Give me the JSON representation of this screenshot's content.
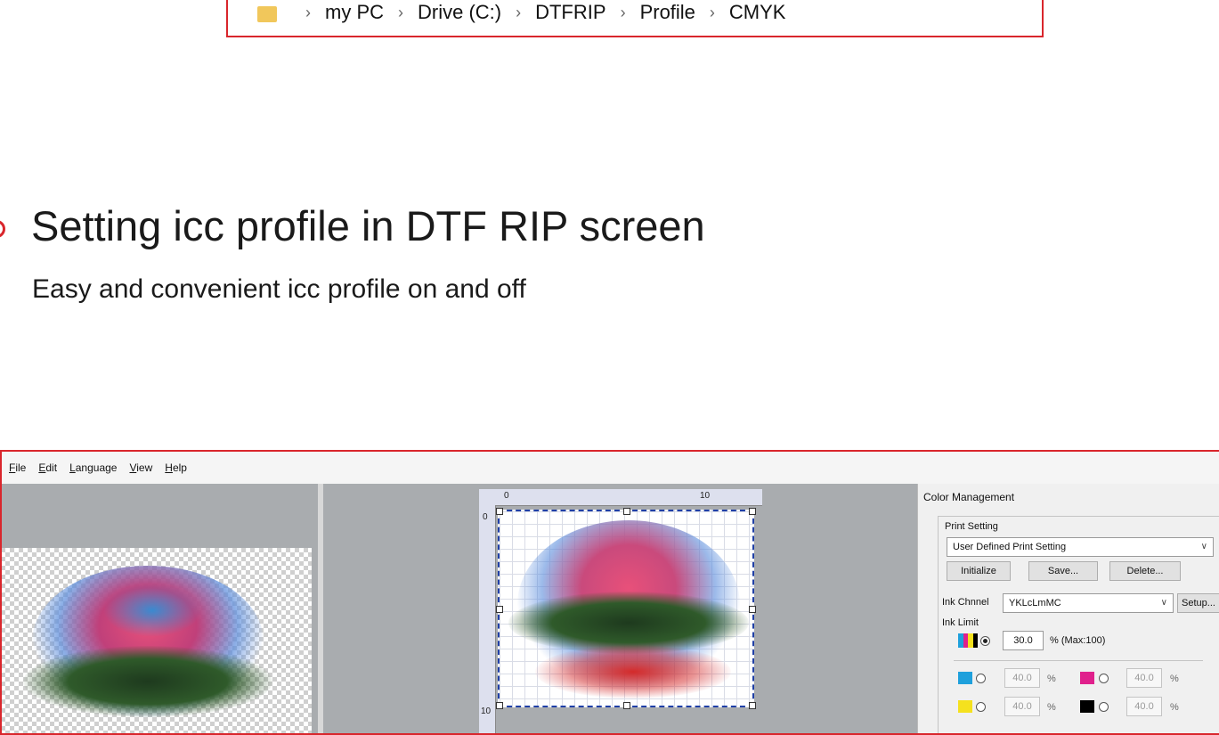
{
  "breadcrumb": {
    "items": [
      "my PC",
      "Drive (C:)",
      "DTFRIP",
      "Profile",
      "CMYK"
    ],
    "separator": "›"
  },
  "headline": "Setting icc profile in DTF RIP screen",
  "subline": "Easy and convenient icc profile on and off",
  "menu": [
    {
      "key": "F",
      "rest": "ile"
    },
    {
      "key": "E",
      "rest": "dit"
    },
    {
      "key": "L",
      "rest": "anguage"
    },
    {
      "key": "V",
      "rest": "iew"
    },
    {
      "key": "H",
      "rest": "elp"
    }
  ],
  "ruler": {
    "top_labels": [
      "0",
      "10"
    ],
    "left_labels": [
      "0",
      "10"
    ]
  },
  "color_management": {
    "title": "Color Management",
    "print_setting": {
      "label": "Print Setting",
      "selected": "User Defined Print Setting",
      "buttons": [
        "Initialize",
        "Save...",
        "Delete..."
      ]
    },
    "ink_channel": {
      "label": "Ink Chnnel",
      "selected": "YKLcLmMC",
      "setup_button": "Setup..."
    },
    "ink_limit": {
      "label": "Ink Limit",
      "total_value": "30.0",
      "total_suffix": "% (Max:100)",
      "channels": [
        {
          "name": "cyan",
          "value": "40.0",
          "unit": "%",
          "color": "#1ea0dc"
        },
        {
          "name": "magenta",
          "value": "40.0",
          "unit": "%",
          "color": "#e0208c"
        },
        {
          "name": "yellow",
          "value": "40.0",
          "unit": "%",
          "color": "#f5e11e"
        },
        {
          "name": "black",
          "value": "40.0",
          "unit": "%",
          "color": "#000000"
        }
      ]
    }
  },
  "colors": {
    "accent_red": "#d9262c",
    "pane_gray": "#a9acaf",
    "selection_blue": "#1f3fa6"
  }
}
